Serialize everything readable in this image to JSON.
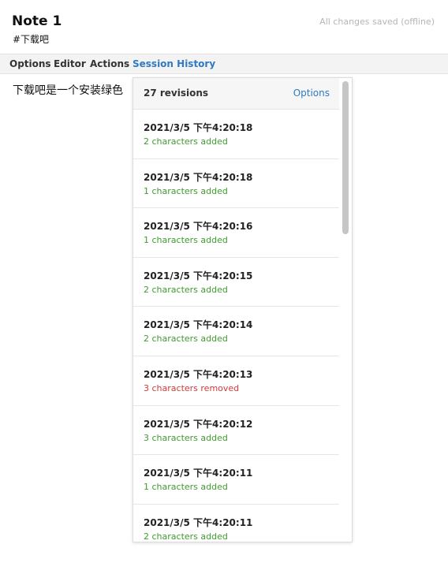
{
  "note": {
    "title": "Note 1",
    "tag": "#下载吧",
    "save_status": "All changes saved (offline)"
  },
  "menu": {
    "items": [
      {
        "label": "Options",
        "active": false
      },
      {
        "label": "Editor",
        "active": false
      },
      {
        "label": "Actions",
        "active": false
      },
      {
        "label": "Session History",
        "active": true
      }
    ]
  },
  "editor": {
    "text": "下载吧是一个安装绿色"
  },
  "history": {
    "revision_count": "27 revisions",
    "options_label": "Options",
    "revisions": [
      {
        "time": "2021/3/5 下午4:20:18",
        "change": "2 characters added",
        "type": "added"
      },
      {
        "time": "2021/3/5 下午4:20:18",
        "change": "1 characters added",
        "type": "added"
      },
      {
        "time": "2021/3/5 下午4:20:16",
        "change": "1 characters added",
        "type": "added"
      },
      {
        "time": "2021/3/5 下午4:20:15",
        "change": "2 characters added",
        "type": "added"
      },
      {
        "time": "2021/3/5 下午4:20:14",
        "change": "2 characters added",
        "type": "added"
      },
      {
        "time": "2021/3/5 下午4:20:13",
        "change": "3 characters removed",
        "type": "removed"
      },
      {
        "time": "2021/3/5 下午4:20:12",
        "change": "3 characters added",
        "type": "added"
      },
      {
        "time": "2021/3/5 下午4:20:11",
        "change": "1 characters added",
        "type": "added"
      },
      {
        "time": "2021/3/5 下午4:20:11",
        "change": "2 characters added",
        "type": "added"
      }
    ]
  },
  "colors": {
    "accent": "#2f7ac2",
    "added": "#3f9b2f",
    "removed": "#d33a3a"
  }
}
